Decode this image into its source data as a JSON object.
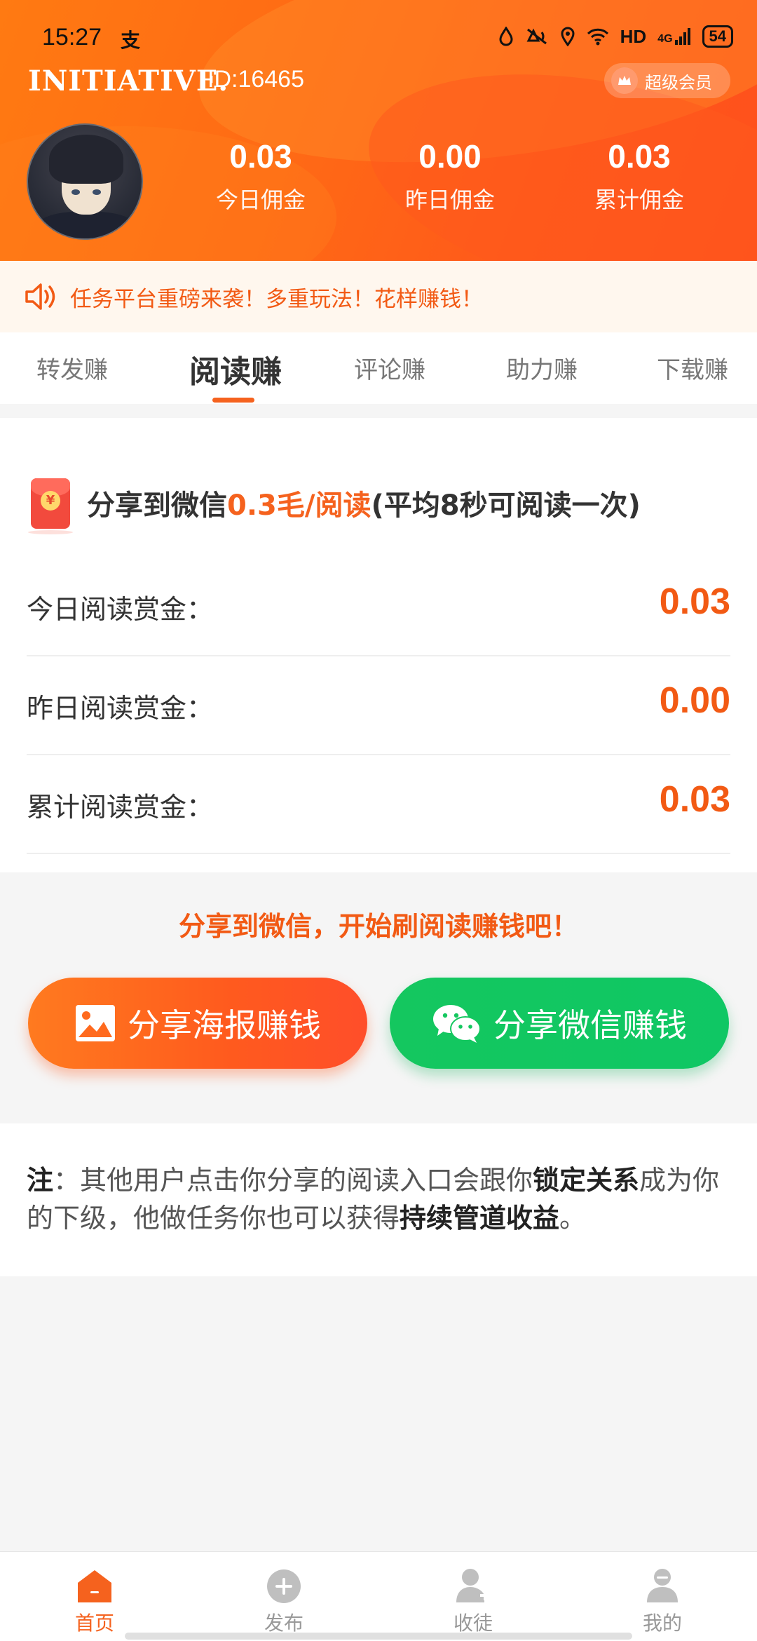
{
  "status_bar": {
    "time": "15:27",
    "extra_glyph": "支",
    "network": "HD",
    "signal": "4G",
    "battery": "54"
  },
  "header": {
    "brand": "INITIATIVE.",
    "user_id": "ID:16465",
    "vip_badge": "超级会员",
    "stats": [
      {
        "value": "0.03",
        "label": "今日佣金"
      },
      {
        "value": "0.00",
        "label": "昨日佣金"
      },
      {
        "value": "0.03",
        "label": "累计佣金"
      }
    ]
  },
  "notice": {
    "text": "任务平台重磅来袭！多重玩法！花样赚钱！"
  },
  "tabs": [
    {
      "label": "转发赚",
      "active": false
    },
    {
      "label": "阅读赚",
      "active": true
    },
    {
      "label": "评论赚",
      "active": false
    },
    {
      "label": "助力赚",
      "active": false
    },
    {
      "label": "下载赚",
      "active": false
    }
  ],
  "reading_card": {
    "title_prefix": "分享到微信",
    "title_rate": "0.3毛/阅读",
    "title_suffix": "(平均8秒可阅读一次)",
    "rows": [
      {
        "label": "今日阅读赏金：",
        "value": "0.03"
      },
      {
        "label": "昨日阅读赏金：",
        "value": "0.00"
      },
      {
        "label": "累计阅读赏金：",
        "value": "0.03"
      }
    ]
  },
  "share": {
    "hint": "分享到微信，开始刷阅读赚钱吧！",
    "poster_button": "分享海报赚钱",
    "wechat_button": "分享微信赚钱"
  },
  "note": {
    "prefix": "注",
    "text1": "：其他用户点击你分享的阅读入口会跟你",
    "bold1": "锁定关系",
    "text2": "成为你的下级，他做任务你也可以获得",
    "bold2": "持续管道收益",
    "text3": "。"
  },
  "bottom_nav": [
    {
      "label": "首页",
      "icon": "home-icon",
      "active": true
    },
    {
      "label": "发布",
      "icon": "plus-circle-icon",
      "active": false
    },
    {
      "label": "收徒",
      "icon": "add-user-icon",
      "active": false
    },
    {
      "label": "我的",
      "icon": "user-icon",
      "active": false
    }
  ],
  "colors": {
    "accent": "#f5621e",
    "wechat_green": "#14c75f",
    "header_orange": "#ff6a15"
  }
}
